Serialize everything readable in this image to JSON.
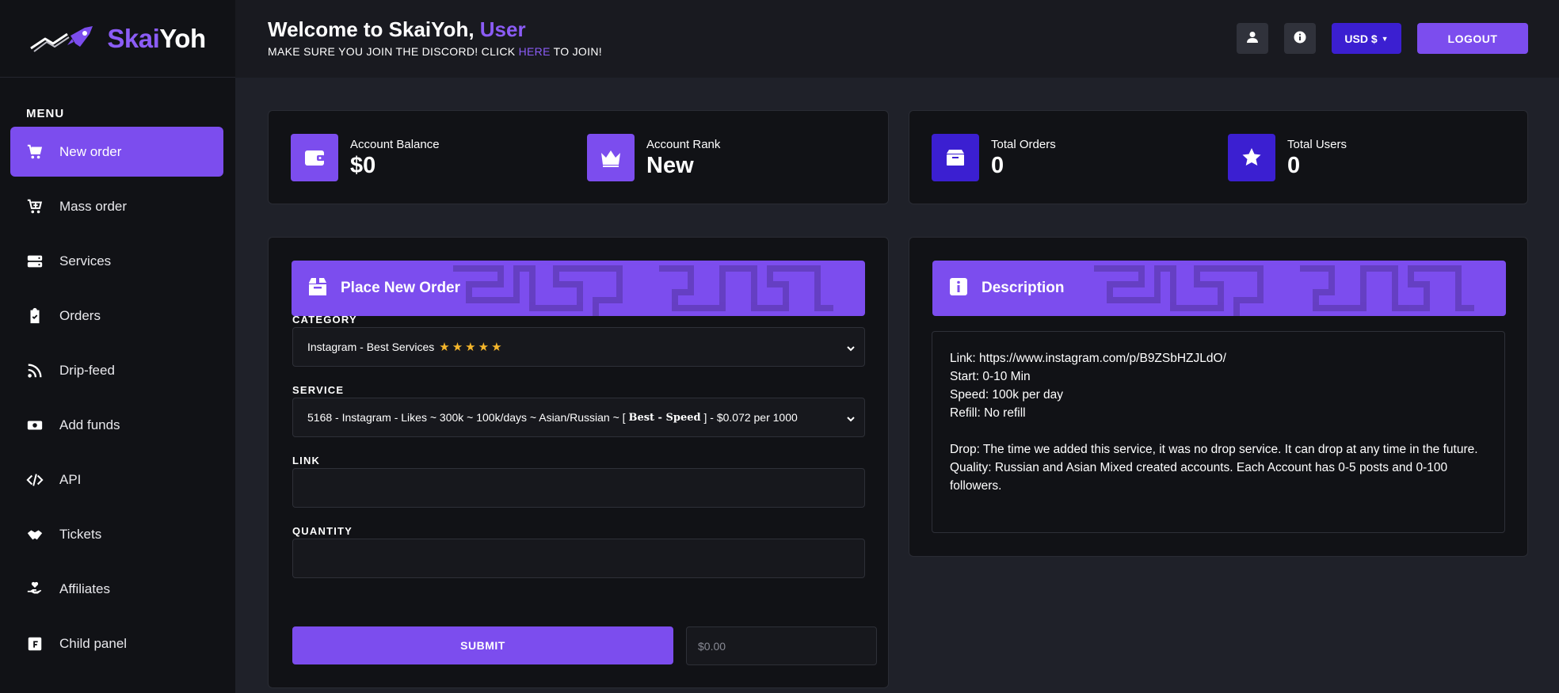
{
  "brand": {
    "part1": "Skai",
    "part2": "Yoh"
  },
  "sidebar": {
    "menu_title": "MENU",
    "items": [
      {
        "label": "New order",
        "icon": "cart-icon",
        "active": true
      },
      {
        "label": "Mass order",
        "icon": "cart-plus-icon"
      },
      {
        "label": "Services",
        "icon": "server-icon"
      },
      {
        "label": "Orders",
        "icon": "clipboard-check-icon"
      },
      {
        "label": "Drip-feed",
        "icon": "rss-icon"
      },
      {
        "label": "Add funds",
        "icon": "money-icon"
      },
      {
        "label": "API",
        "icon": "code-icon"
      },
      {
        "label": "Tickets",
        "icon": "handshake-icon"
      },
      {
        "label": "Affiliates",
        "icon": "hand-heart-icon"
      },
      {
        "label": "Child panel",
        "icon": "square-f-icon"
      }
    ]
  },
  "header": {
    "welcome_prefix": "Welcome to SkaiYoh, ",
    "username": "User",
    "notice_prefix": "MAKE SURE YOU JOIN THE DISCORD! CLICK ",
    "notice_link": "HERE",
    "notice_suffix": " TO JOIN!",
    "currency_label": "USD $",
    "logout_label": "LOGOUT"
  },
  "stats": {
    "balance_label": "Account Balance",
    "balance_value": "$0",
    "rank_label": "Account Rank",
    "rank_value": "New",
    "orders_label": "Total Orders",
    "orders_value": "0",
    "users_label": "Total Users",
    "users_value": "0"
  },
  "order_form": {
    "title": "Place New Order",
    "category_label": "CATEGORY",
    "category_value": "Instagram - Best Services",
    "category_stars": "★★★★★",
    "service_label": "SERVICE",
    "service_prefix": "5168 - Instagram - Likes ~ 300k ~ 100k/days ~ Asian/Russian ~ [ ",
    "service_bold": "Best - Speed",
    "service_suffix": " ] - $0.072 per 1000",
    "link_label": "LINK",
    "link_value": "",
    "quantity_label": "QUANTITY",
    "quantity_value": "",
    "submit_label": "SUBMIT",
    "price": "$0.00"
  },
  "description": {
    "title": "Description",
    "lines": [
      "Link: https://www.instagram.com/p/B9ZSbHZJLdO/",
      "Start: 0-10 Min",
      "Speed: 100k per day",
      "Refill: No refill",
      "",
      "Drop: The time we added this service, it was no drop service. It can drop at any time in the future.",
      "Quality: Russian and Asian Mixed created accounts. Each Account has 0-5 posts and 0-100 followers."
    ]
  },
  "colors": {
    "accent": "#7c4dee",
    "accent_dark": "#3b1fd1",
    "bg": "#1f2129",
    "sidebar_bg": "#111216"
  }
}
